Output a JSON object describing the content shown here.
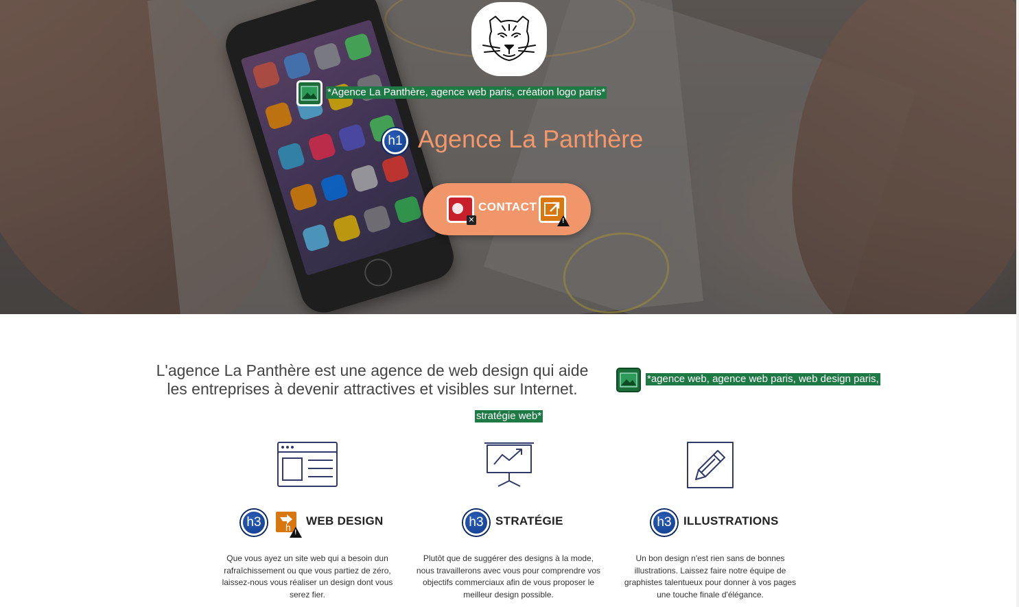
{
  "hero": {
    "logo_alt": "*Agence La Panthère, agence web paris, création logo paris*",
    "title": "Agence La Panthère",
    "title_badge": "h1",
    "cta_label": "CONTACT"
  },
  "intro": {
    "text": "L'agence La Panthère est une agence de web design qui aide les entreprises à devenir attractives et visibles sur Internet.",
    "image_alt_line1": "*agence web, agence web paris, web design paris,",
    "image_alt_line2": "stratégie web*"
  },
  "services": [
    {
      "badge": "h3",
      "title": "WEB DESIGN",
      "icon": "browser-layout-icon",
      "text": "Que vous ayez un site web qui a besoin dun rafraîchissement ou que vous partiez de zéro, laissez-nous vous réaliser un design dont vous serez fier."
    },
    {
      "badge": "h3",
      "title": "STRATÉGIE",
      "icon": "presentation-chart-icon",
      "text": "Plutôt que de suggérer des designs à la mode, nous travaillerons avec vous pour comprendre vos objectifs commerciaux afin de vous proposer le meilleur design possible."
    },
    {
      "badge": "h3",
      "title": "ILLUSTRATIONS",
      "icon": "pencil-edit-icon",
      "text": "Un bon design n'est rien sans de bonnes illustrations. Laissez faire notre équipe de graphistes talentueux pour donner à vos pages une touche finale d'élégance."
    }
  ],
  "colors": {
    "accent": "#f0966a",
    "heading": "#f4976a",
    "alt_label_bg": "#1e7a44",
    "heading_badge": "#0e3a8a",
    "icon_stroke": "#2f3a68"
  }
}
